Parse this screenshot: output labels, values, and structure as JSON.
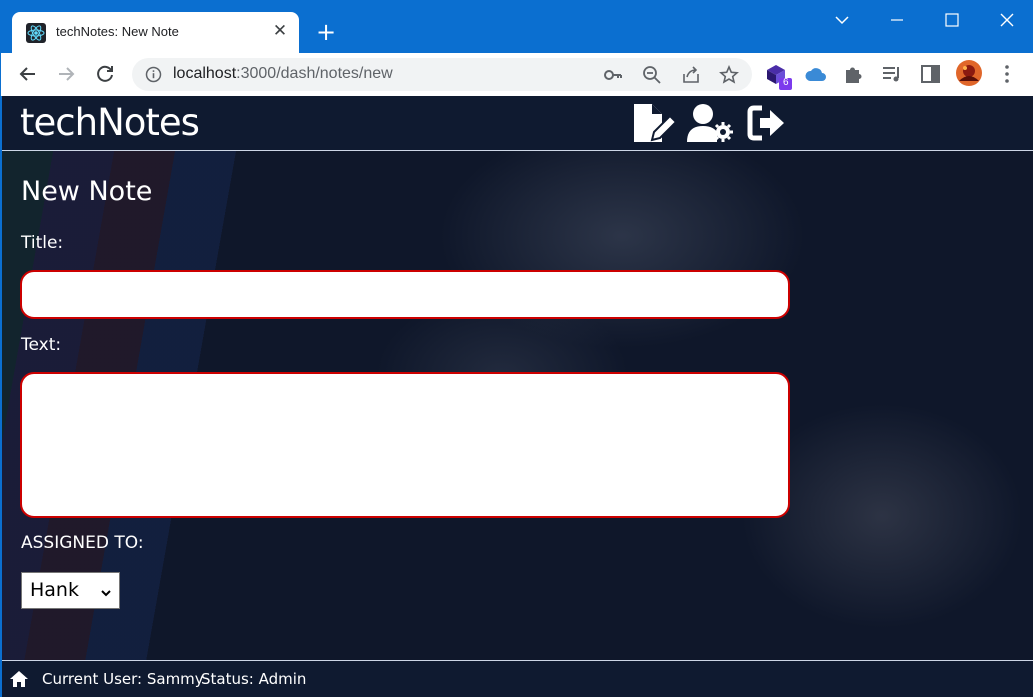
{
  "browser": {
    "tab_title": "techNotes: New Note",
    "tab_close": "✕",
    "new_tab": "+",
    "url_host": "localhost",
    "url_rest": ":3000/dash/notes/new",
    "extension_badge": "6"
  },
  "header": {
    "logo": "techNotes",
    "icons": [
      "new-note-icon",
      "user-settings-icon",
      "logout-icon"
    ]
  },
  "form": {
    "title": "New Note",
    "title_label": "Title:",
    "title_value": "",
    "text_label": "Text:",
    "text_value": "",
    "assigned_label": "ASSIGNED TO:",
    "assigned_value": "Hank"
  },
  "footer": {
    "current_user": "Current User: Sammy",
    "status": "Status: Admin"
  },
  "colors": {
    "chrome_blue": "#0b6fd0",
    "page_bg": "#0f172a",
    "error_border": "#cc0000"
  }
}
